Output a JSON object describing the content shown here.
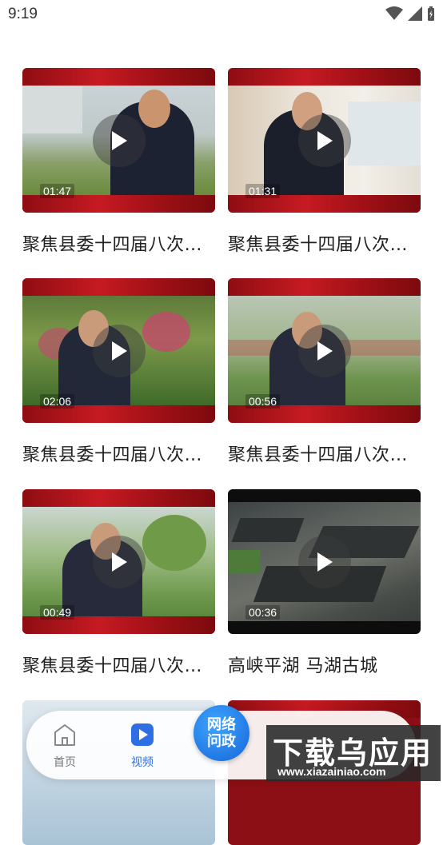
{
  "status_bar": {
    "time": "9:19"
  },
  "videos": [
    {
      "duration": "01:47",
      "title": "聚焦县委十四届八次全会"
    },
    {
      "duration": "01:31",
      "title": "聚焦县委十四届八次全会"
    },
    {
      "duration": "02:06",
      "title": "聚焦县委十四届八次全会"
    },
    {
      "duration": "00:56",
      "title": "聚焦县委十四届八次全会"
    },
    {
      "duration": "00:49",
      "title": "聚焦县委十四届八次全会"
    },
    {
      "duration": "00:36",
      "title": "高峡平湖 马湖古城"
    }
  ],
  "bottom_nav": {
    "home_label": "首页",
    "video_label": "视频",
    "center_line1": "网络",
    "center_line2": "问政",
    "active_color": "#2f6fe4",
    "inactive_color": "#777777"
  },
  "watermark": {
    "main": "下载乌应用",
    "url": "www.xiazainiao.com"
  }
}
